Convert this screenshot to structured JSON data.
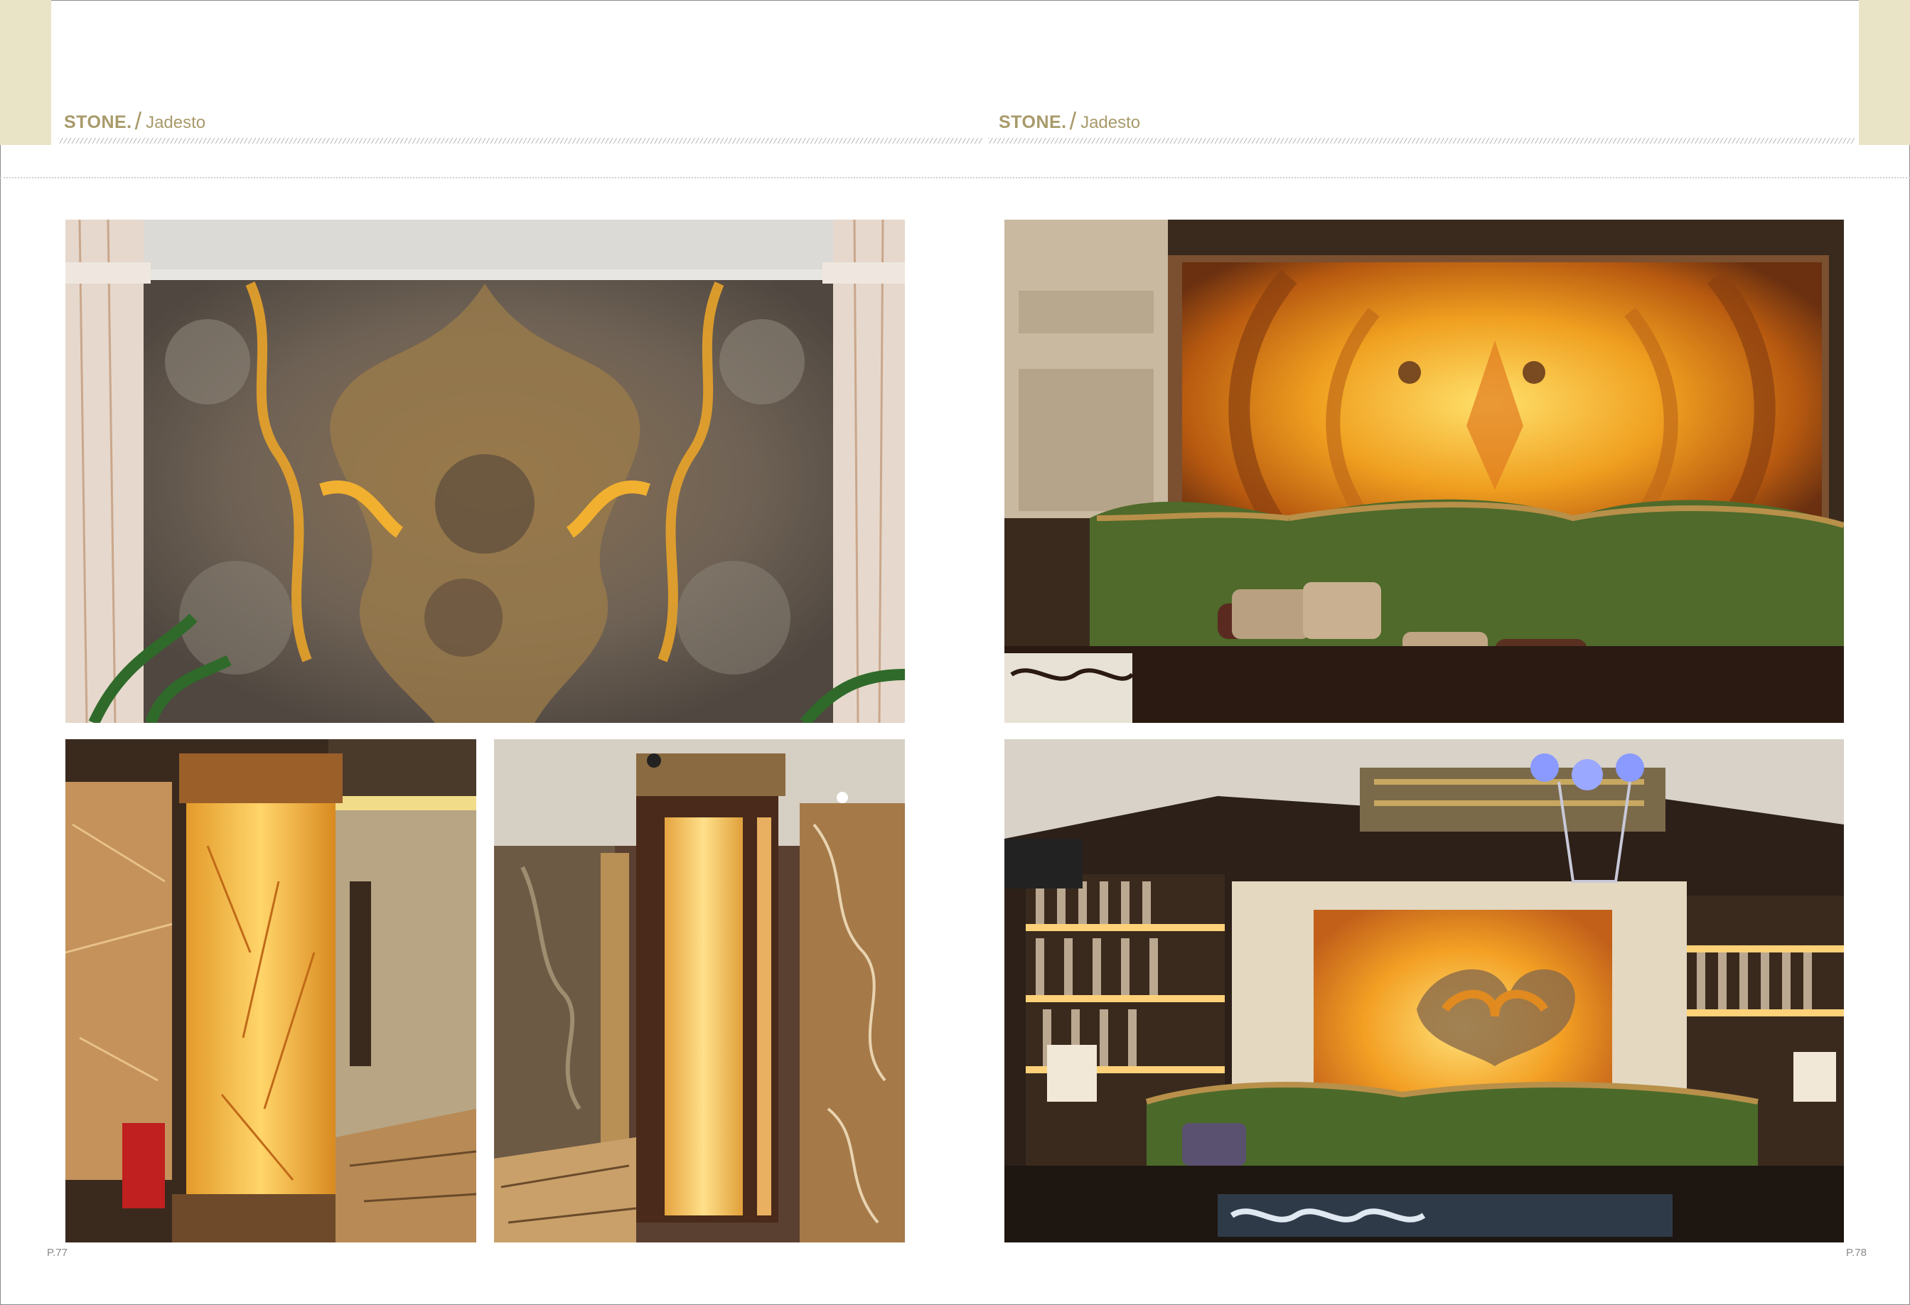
{
  "header": {
    "brand": "STONE.",
    "series": "Jadesto"
  },
  "pages": {
    "left_number": "P.77",
    "right_number": "P.78"
  },
  "colors": {
    "tab": "#e9e4c6",
    "header_text": "#a89a6a",
    "page_number": "#8a8a8a"
  },
  "photos": [
    {
      "name": "onyx-wall-panel-columns",
      "subject": "grey and amber onyx feature wall framed by white marble columns"
    },
    {
      "name": "backlit-onyx-pillar-hallway",
      "subject": "backlit honey onyx pillar in a marble hallway"
    },
    {
      "name": "backlit-onyx-column-corridor",
      "subject": "dark wood column with backlit onyx strip and onyx wall cladding"
    },
    {
      "name": "backlit-onyx-wall-green-sofa",
      "subject": "large backlit orange onyx wall behind a green tufted sofa"
    },
    {
      "name": "backlit-onyx-wall-bookshelves-chandelier",
      "subject": "backlit onyx wall between lit bookshelves with chandelier and green sofa"
    }
  ]
}
